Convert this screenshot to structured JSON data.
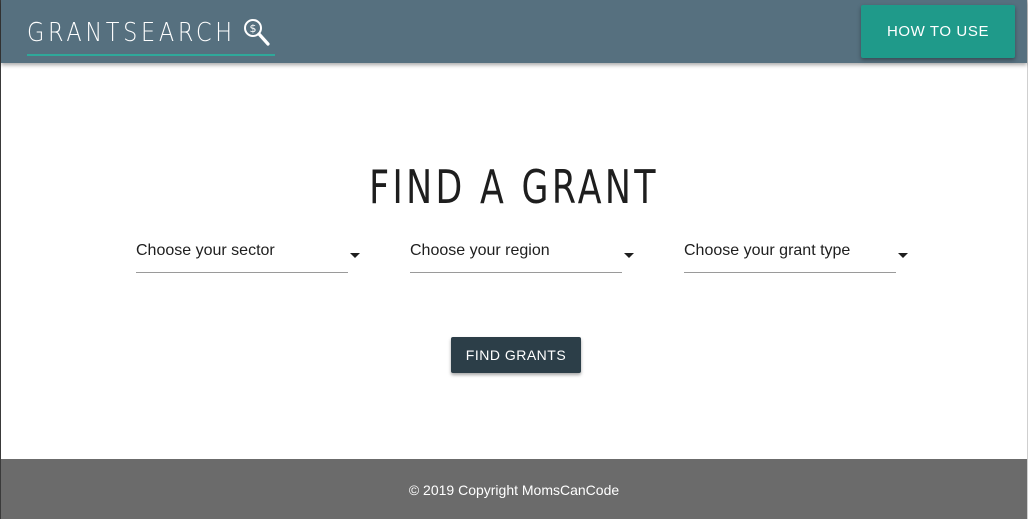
{
  "header": {
    "logo_text": "GRANTSEARCH",
    "logo_icon": "magnifier-dollar-icon",
    "how_to_use_label": "HOW TO USE"
  },
  "main": {
    "title": "FIND A GRANT",
    "selects": [
      {
        "label": "Choose your sector"
      },
      {
        "label": "Choose your region"
      },
      {
        "label": "Choose your grant type"
      }
    ],
    "find_button_label": "FIND GRANTS"
  },
  "footer": {
    "copyright": "© 2019 Copyright MomsCanCode"
  },
  "colors": {
    "header_bg": "#56707f",
    "accent_teal": "#1f9a8a",
    "button_dark": "#2c3e48",
    "footer_bg": "#6b6b6b"
  }
}
